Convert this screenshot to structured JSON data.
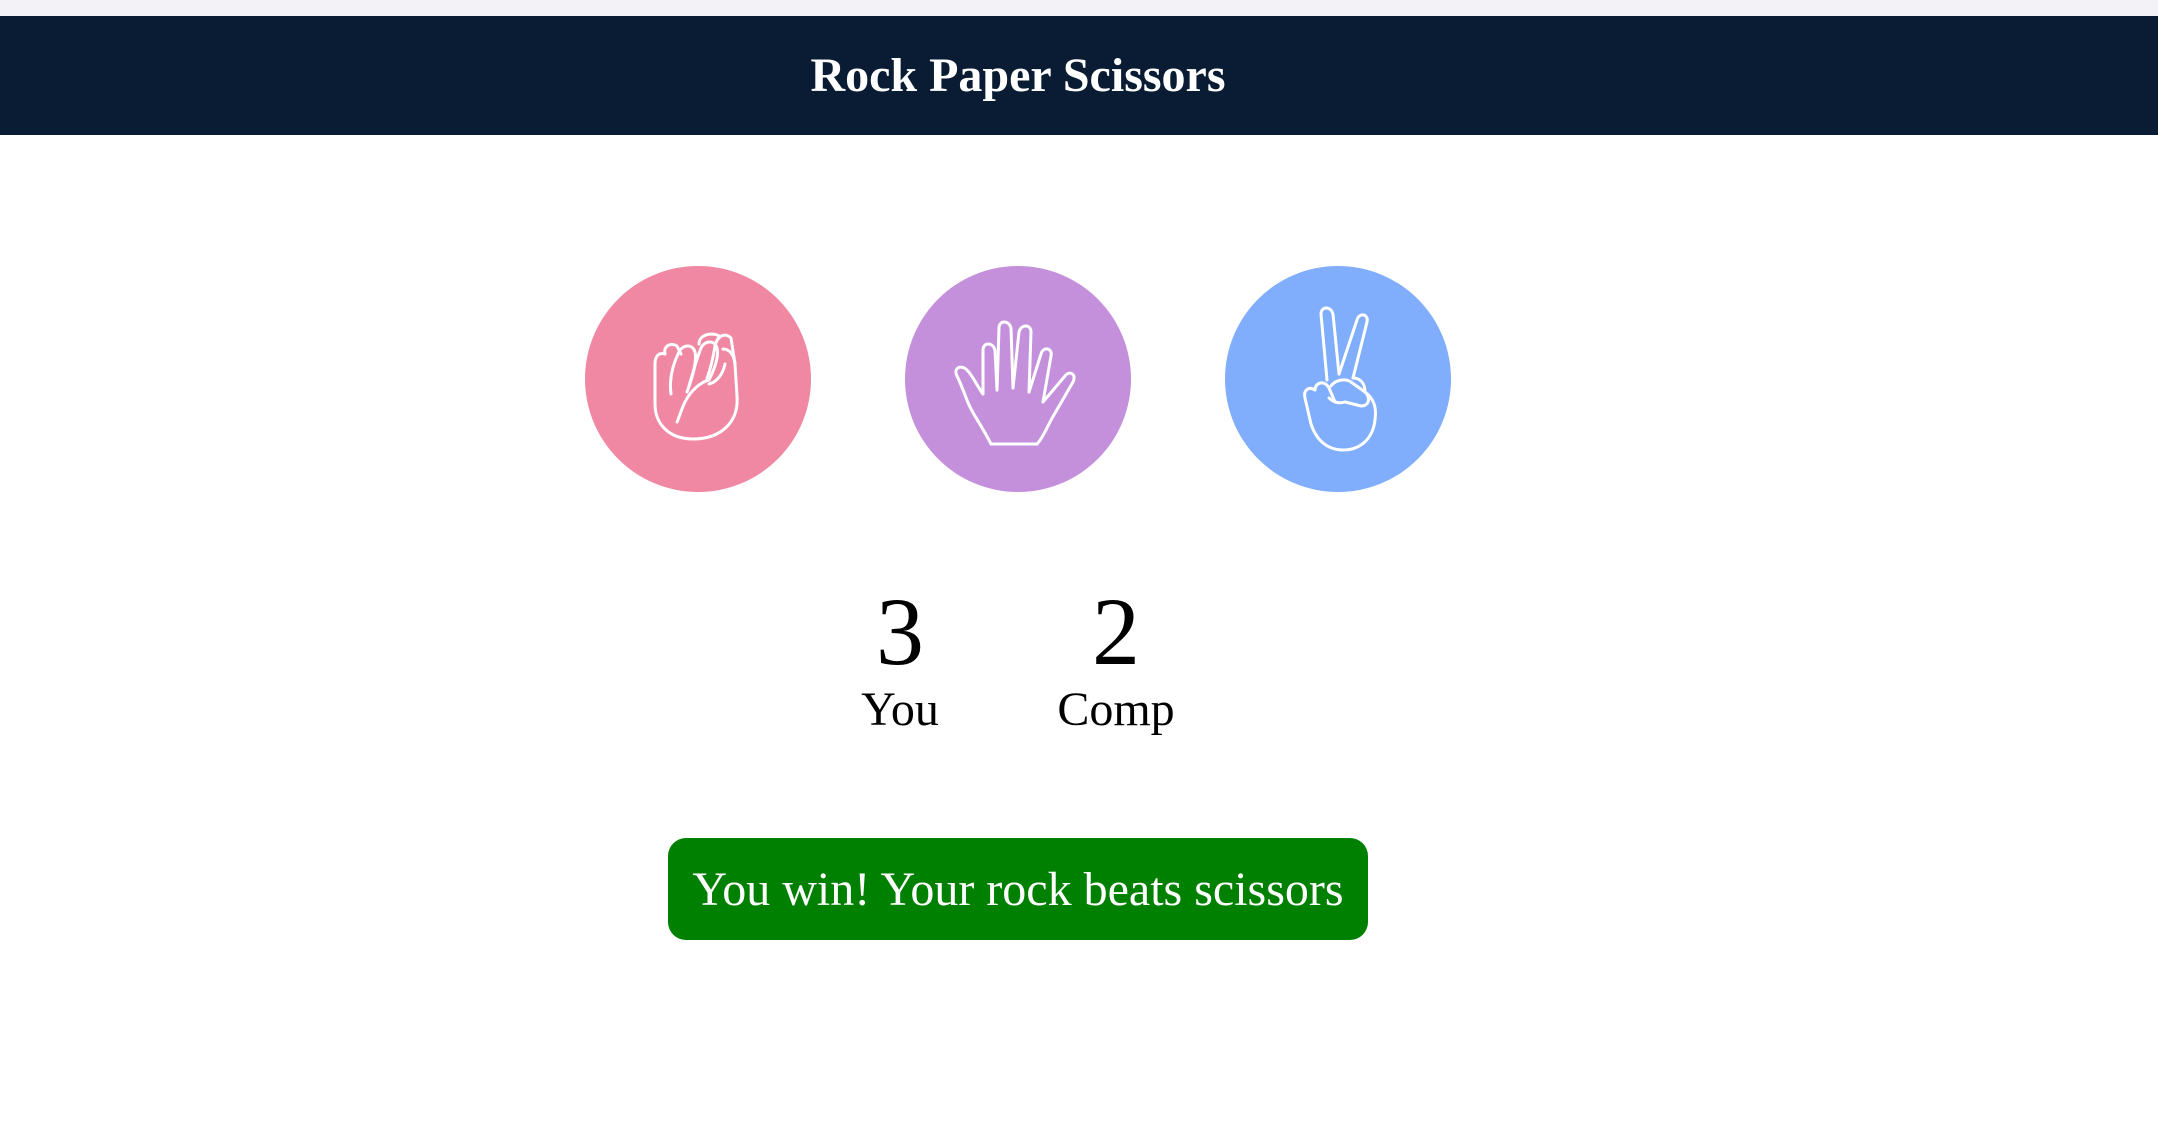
{
  "header": {
    "title": "Rock Paper Scissors"
  },
  "choices": [
    {
      "name": "rock",
      "icon": "fist-icon",
      "color": "#f088a4"
    },
    {
      "name": "paper",
      "icon": "open-hand-icon",
      "color": "#c490dc"
    },
    {
      "name": "scissors",
      "icon": "victory-hand-icon",
      "color": "#80aefc"
    }
  ],
  "scoreboard": {
    "you": {
      "value": "3",
      "label": "You"
    },
    "comp": {
      "value": "2",
      "label": "Comp"
    }
  },
  "result": {
    "message": "You win! Your rock beats scissors",
    "color": "#008000"
  },
  "colors": {
    "header_bg": "#0a1c33"
  }
}
